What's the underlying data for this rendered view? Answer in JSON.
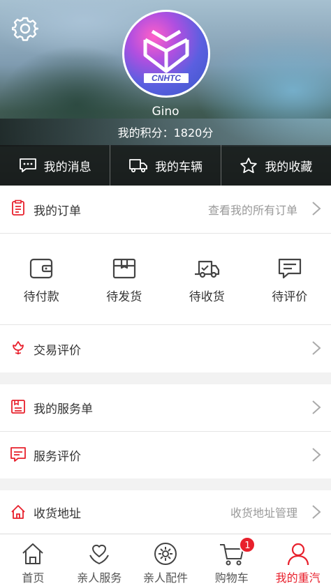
{
  "profile": {
    "username": "Gino",
    "points_text": "我的积分：1820分",
    "logo_text": "CNHTC"
  },
  "quickbar": [
    {
      "label": "我的消息",
      "icon": "message-icon"
    },
    {
      "label": "我的车辆",
      "icon": "truck-icon"
    },
    {
      "label": "我的收藏",
      "icon": "star-icon"
    }
  ],
  "orders": {
    "label": "我的订单",
    "hint": "查看我的所有订单",
    "statuses": [
      {
        "label": "待付款",
        "icon": "wallet-icon"
      },
      {
        "label": "待发货",
        "icon": "package-icon"
      },
      {
        "label": "待收货",
        "icon": "delivery-truck-icon"
      },
      {
        "label": "待评价",
        "icon": "comment-icon"
      }
    ]
  },
  "trade_review": {
    "label": "交易评价"
  },
  "service_orders": {
    "label": "我的服务单"
  },
  "service_review": {
    "label": "服务评价"
  },
  "address": {
    "label": "收货地址",
    "hint": "收货地址管理"
  },
  "tabbar": {
    "items": [
      {
        "label": "首页",
        "icon": "home-icon"
      },
      {
        "label": "亲人服务",
        "icon": "heart-hands-icon"
      },
      {
        "label": "亲人配件",
        "icon": "gear-part-icon"
      },
      {
        "label": "购物车",
        "icon": "cart-icon",
        "badge": "1"
      },
      {
        "label": "我的重汽",
        "icon": "person-icon",
        "active": true
      }
    ]
  },
  "colors": {
    "accent": "#e8202c",
    "text": "#333333",
    "hint": "#999999",
    "background": "#f2f2f2"
  }
}
